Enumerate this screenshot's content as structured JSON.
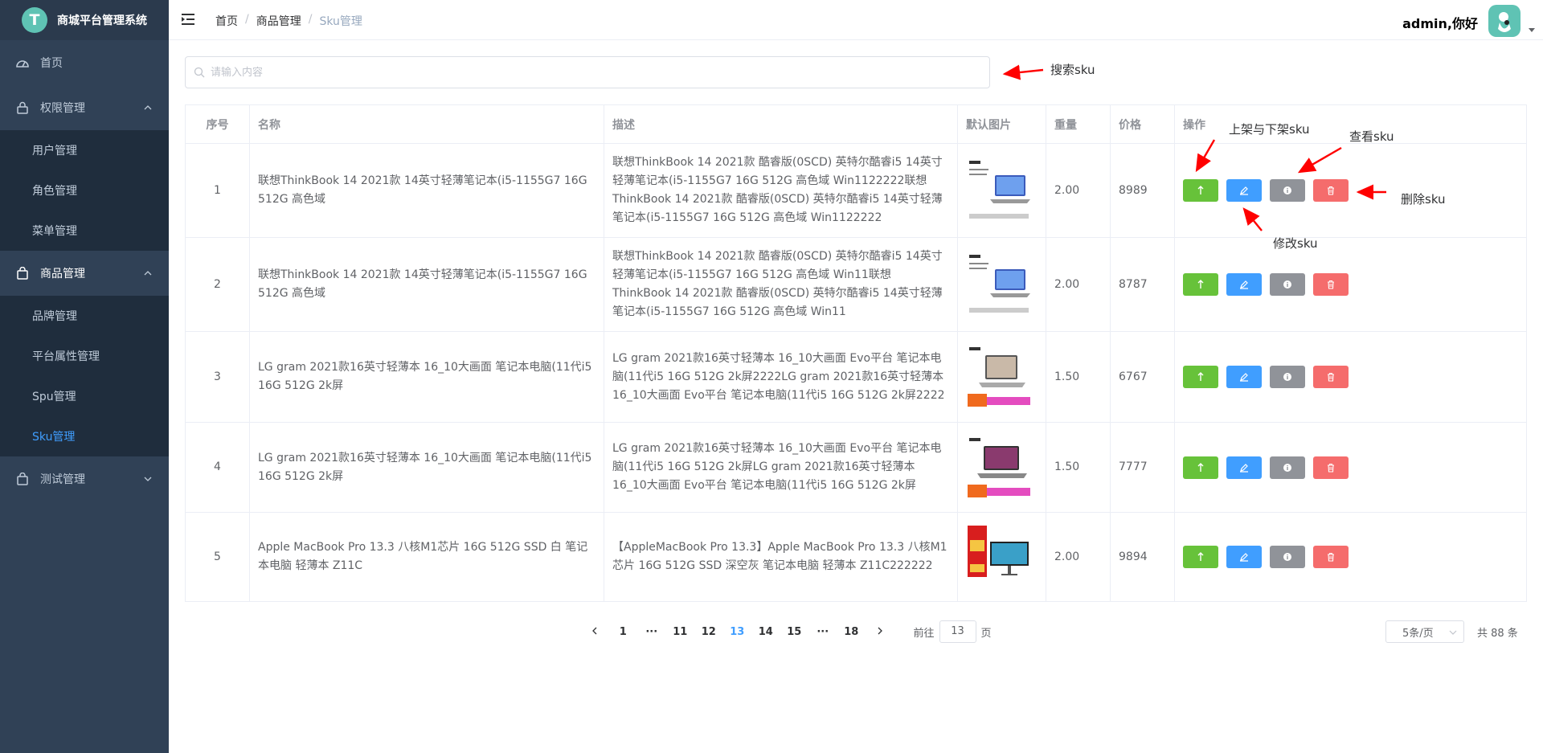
{
  "app": {
    "logo_letter": "T",
    "title": "商城平台管理系统"
  },
  "sidebar": {
    "home": "首页",
    "groups": [
      {
        "label": "权限管理",
        "items": [
          "用户管理",
          "角色管理",
          "菜单管理"
        ]
      },
      {
        "label": "商品管理",
        "items": [
          "品牌管理",
          "平台属性管理",
          "Spu管理",
          "Sku管理"
        ]
      },
      {
        "label": "测试管理",
        "items": []
      }
    ],
    "active_item": "Sku管理"
  },
  "breadcrumb": [
    "首页",
    "商品管理",
    "Sku管理"
  ],
  "user": {
    "greeting": "admin,你好"
  },
  "search": {
    "placeholder": "请输入内容",
    "value": ""
  },
  "table": {
    "headers": [
      "序号",
      "名称",
      "描述",
      "默认图片",
      "重量",
      "价格",
      "操作"
    ],
    "rows": [
      {
        "idx": "1",
        "name": "联想ThinkBook 14 2021款 14英寸轻薄笔记本(i5-1155G7 16G 512G 高色域",
        "desc": "联想ThinkBook 14 2021款 酷睿版(0SCD) 英特尔酷睿i5 14英寸轻薄笔记本(i5-1155G7 16G 512G 高色域 Win1122222联想ThinkBook 14 2021款 酷睿版(0SCD) 英特尔酷睿i5 14英寸轻薄笔记本(i5-1155G7 16G 512G 高色域 Win1122222",
        "weight": "2.00",
        "price": "8989"
      },
      {
        "idx": "2",
        "name": "联想ThinkBook 14 2021款 14英寸轻薄笔记本(i5-1155G7 16G 512G 高色域",
        "desc": "联想ThinkBook 14 2021款 酷睿版(0SCD) 英特尔酷睿i5 14英寸轻薄笔记本(i5-1155G7 16G 512G 高色域 Win11联想ThinkBook 14 2021款 酷睿版(0SCD) 英特尔酷睿i5 14英寸轻薄笔记本(i5-1155G7 16G 512G 高色域 Win11",
        "weight": "2.00",
        "price": "8787"
      },
      {
        "idx": "3",
        "name": "LG gram 2021款16英寸轻薄本 16_10大画面 笔记本电脑(11代i5 16G 512G 2k屏",
        "desc": "LG gram 2021款16英寸轻薄本 16_10大画面 Evo平台 笔记本电脑(11代i5 16G 512G 2k屏2222LG gram 2021款16英寸轻薄本 16_10大画面 Evo平台 笔记本电脑(11代i5 16G 512G 2k屏2222",
        "weight": "1.50",
        "price": "6767"
      },
      {
        "idx": "4",
        "name": "LG gram 2021款16英寸轻薄本 16_10大画面 笔记本电脑(11代i5 16G 512G 2k屏",
        "desc": "LG gram 2021款16英寸轻薄本 16_10大画面 Evo平台 笔记本电脑(11代i5 16G 512G 2k屏LG gram 2021款16英寸轻薄本 16_10大画面 Evo平台 笔记本电脑(11代i5 16G 512G 2k屏",
        "weight": "1.50",
        "price": "7777"
      },
      {
        "idx": "5",
        "name": "Apple MacBook Pro 13.3 八核M1芯片 16G 512G SSD 白 笔记本电脑 轻薄本 Z11C",
        "desc": "【AppleMacBook Pro 13.3】Apple MacBook Pro 13.3 八核M1芯片 16G 512G SSD 深空灰 笔记本电脑 轻薄本 Z11C222222",
        "weight": "2.00",
        "price": "9894"
      }
    ]
  },
  "pagination": {
    "pages": [
      "1",
      "···",
      "11",
      "12",
      "13",
      "14",
      "15",
      "···",
      "18"
    ],
    "current": "13",
    "jump_prefix": "前往",
    "jump_value": "13",
    "jump_suffix": "页",
    "page_size": "5条/页",
    "total": "共 88 条"
  },
  "annotations": {
    "search": "搜索sku",
    "onsale": "上架与下架sku",
    "view": "查看sku",
    "delete": "删除sku",
    "edit": "修改sku"
  },
  "colors": {
    "sidebar_bg": "#304156",
    "active": "#409eff",
    "green": "#67c23a",
    "gray": "#909399",
    "red": "#f56c6c",
    "annotation_arrow": "#ff0000"
  },
  "icons": [
    "dashboard-icon",
    "lock-icon",
    "shopping-bag-icon",
    "hamburger-icon",
    "search-icon",
    "arrow-up-icon",
    "edit-icon",
    "info-icon",
    "delete-icon"
  ]
}
